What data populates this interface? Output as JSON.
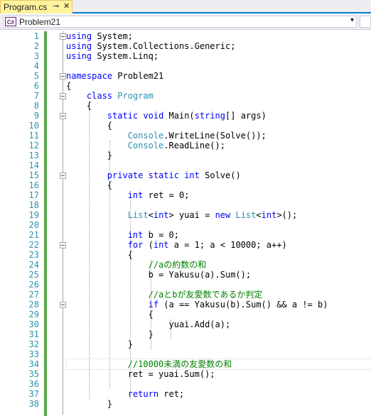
{
  "tab": {
    "title": "Program.cs",
    "pin_icon": "pin-icon",
    "close_icon": "close-icon"
  },
  "nav": {
    "icon_text": "C#",
    "label": "Problem21"
  },
  "lines": [
    {
      "n": "1",
      "t": [
        [
          "kw",
          "using"
        ],
        [
          "pl",
          " System;"
        ]
      ]
    },
    {
      "n": "2",
      "t": [
        [
          "kw",
          "using"
        ],
        [
          "pl",
          " System.Collections.Generic;"
        ]
      ]
    },
    {
      "n": "3",
      "t": [
        [
          "kw",
          "using"
        ],
        [
          "pl",
          " System.Linq;"
        ]
      ]
    },
    {
      "n": "4",
      "t": []
    },
    {
      "n": "5",
      "t": [
        [
          "kw",
          "namespace"
        ],
        [
          "pl",
          " Problem21"
        ]
      ]
    },
    {
      "n": "6",
      "t": [
        [
          "pl",
          "{"
        ]
      ]
    },
    {
      "n": "7",
      "t": [
        [
          "pl",
          "    "
        ],
        [
          "kw",
          "class"
        ],
        [
          "pl",
          " "
        ],
        [
          "ty",
          "Program"
        ]
      ]
    },
    {
      "n": "8",
      "t": [
        [
          "pl",
          "    {"
        ]
      ]
    },
    {
      "n": "9",
      "t": [
        [
          "pl",
          "        "
        ],
        [
          "kw",
          "static"
        ],
        [
          "pl",
          " "
        ],
        [
          "kw",
          "void"
        ],
        [
          "pl",
          " Main("
        ],
        [
          "kw",
          "string"
        ],
        [
          "pl",
          "[] args)"
        ]
      ]
    },
    {
      "n": "10",
      "t": [
        [
          "pl",
          "        {"
        ]
      ]
    },
    {
      "n": "11",
      "t": [
        [
          "pl",
          "            "
        ],
        [
          "ty",
          "Console"
        ],
        [
          "pl",
          ".WriteLine(Solve());"
        ]
      ]
    },
    {
      "n": "12",
      "t": [
        [
          "pl",
          "            "
        ],
        [
          "ty",
          "Console"
        ],
        [
          "pl",
          ".ReadLine();"
        ]
      ]
    },
    {
      "n": "13",
      "t": [
        [
          "pl",
          "        }"
        ]
      ]
    },
    {
      "n": "14",
      "t": []
    },
    {
      "n": "15",
      "t": [
        [
          "pl",
          "        "
        ],
        [
          "kw",
          "private"
        ],
        [
          "pl",
          " "
        ],
        [
          "kw",
          "static"
        ],
        [
          "pl",
          " "
        ],
        [
          "kw",
          "int"
        ],
        [
          "pl",
          " Solve()"
        ]
      ]
    },
    {
      "n": "16",
      "t": [
        [
          "pl",
          "        {"
        ]
      ]
    },
    {
      "n": "17",
      "t": [
        [
          "pl",
          "            "
        ],
        [
          "kw",
          "int"
        ],
        [
          "pl",
          " ret = 0;"
        ]
      ]
    },
    {
      "n": "18",
      "t": []
    },
    {
      "n": "19",
      "t": [
        [
          "pl",
          "            "
        ],
        [
          "ty",
          "List"
        ],
        [
          "pl",
          "<"
        ],
        [
          "kw",
          "int"
        ],
        [
          "pl",
          "> yuai = "
        ],
        [
          "kw",
          "new"
        ],
        [
          "pl",
          " "
        ],
        [
          "ty",
          "List"
        ],
        [
          "pl",
          "<"
        ],
        [
          "kw",
          "int"
        ],
        [
          "pl",
          ">();"
        ]
      ]
    },
    {
      "n": "20",
      "t": []
    },
    {
      "n": "21",
      "t": [
        [
          "pl",
          "            "
        ],
        [
          "kw",
          "int"
        ],
        [
          "pl",
          " b = 0;"
        ]
      ]
    },
    {
      "n": "22",
      "t": [
        [
          "pl",
          "            "
        ],
        [
          "kw",
          "for"
        ],
        [
          "pl",
          " ("
        ],
        [
          "kw",
          "int"
        ],
        [
          "pl",
          " a = 1; a < 10000; a++)"
        ]
      ]
    },
    {
      "n": "23",
      "t": [
        [
          "pl",
          "            {"
        ]
      ]
    },
    {
      "n": "24",
      "t": [
        [
          "pl",
          "                "
        ],
        [
          "cm",
          "//aの約数の和"
        ]
      ]
    },
    {
      "n": "25",
      "t": [
        [
          "pl",
          "                b = Yakusu(a).Sum();"
        ]
      ]
    },
    {
      "n": "26",
      "t": []
    },
    {
      "n": "27",
      "t": [
        [
          "pl",
          "                "
        ],
        [
          "cm",
          "//aとbが友愛数であるか判定"
        ]
      ]
    },
    {
      "n": "28",
      "t": [
        [
          "pl",
          "                "
        ],
        [
          "kw",
          "if"
        ],
        [
          "pl",
          " (a == Yakusu(b).Sum() && a != b)"
        ]
      ]
    },
    {
      "n": "29",
      "t": [
        [
          "pl",
          "                {"
        ]
      ]
    },
    {
      "n": "30",
      "t": [
        [
          "pl",
          "                    yuai.Add(a);"
        ]
      ]
    },
    {
      "n": "31",
      "t": [
        [
          "pl",
          "                }"
        ]
      ]
    },
    {
      "n": "32",
      "t": [
        [
          "pl",
          "            }"
        ]
      ]
    },
    {
      "n": "33",
      "t": []
    },
    {
      "n": "34",
      "t": [
        [
          "pl",
          "            "
        ],
        [
          "cm",
          "//10000未満の友愛数の和"
        ]
      ]
    },
    {
      "n": "35",
      "t": [
        [
          "pl",
          "            ret = yuai.Sum();"
        ]
      ]
    },
    {
      "n": "36",
      "t": []
    },
    {
      "n": "37",
      "t": [
        [
          "pl",
          "            "
        ],
        [
          "kw",
          "return"
        ],
        [
          "pl",
          " ret;"
        ]
      ]
    },
    {
      "n": "38",
      "t": [
        [
          "pl",
          "        }"
        ]
      ]
    }
  ],
  "colors": {
    "keyword": "#0000ff",
    "type": "#2b91af",
    "comment": "#008000",
    "line_number": "#2b91af",
    "tab_active": "#fff29d"
  }
}
